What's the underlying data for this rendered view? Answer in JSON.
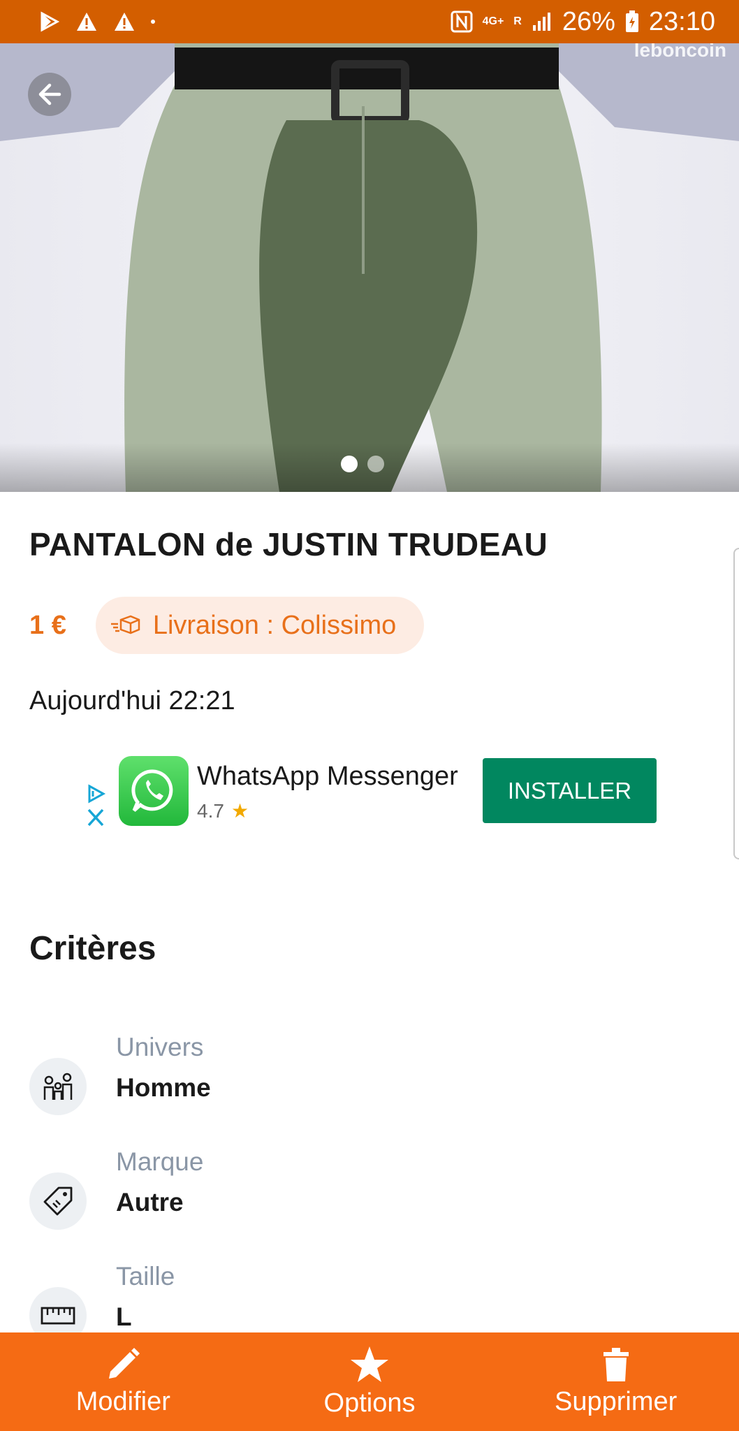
{
  "status_bar": {
    "network": "4G+",
    "roaming": "R",
    "battery": "26%",
    "time": "23:10",
    "icons": [
      "play-store-icon",
      "warning-icon",
      "warning-icon",
      "dot-icon",
      "nfc-icon",
      "signal-icon",
      "battery-icon"
    ]
  },
  "hero": {
    "watermark": "leboncoin",
    "image_count": 2,
    "active_image": 1
  },
  "listing": {
    "title": "PANTALON de JUSTIN TRUDEAU",
    "price": "1 €",
    "delivery": "Livraison : Colissimo",
    "date": "Aujourd'hui 22:21"
  },
  "ad": {
    "app_name": "WhatsApp Messenger",
    "rating": "4.7",
    "install_label": "INSTALLER"
  },
  "criteria": {
    "title": "Critères",
    "items": [
      {
        "label": "Univers",
        "value": "Homme",
        "icon": "people-icon"
      },
      {
        "label": "Marque",
        "value": "Autre",
        "icon": "tag-icon"
      },
      {
        "label": "Taille",
        "value": "L",
        "icon": "ruler-icon"
      }
    ]
  },
  "bottom_bar": {
    "modify": "Modifier",
    "options": "Options",
    "delete": "Supprimer"
  },
  "colors": {
    "status_bar": "#d35e00",
    "accent": "#e8701a",
    "bottom_bar": "#f56b14",
    "install": "#01875f"
  }
}
